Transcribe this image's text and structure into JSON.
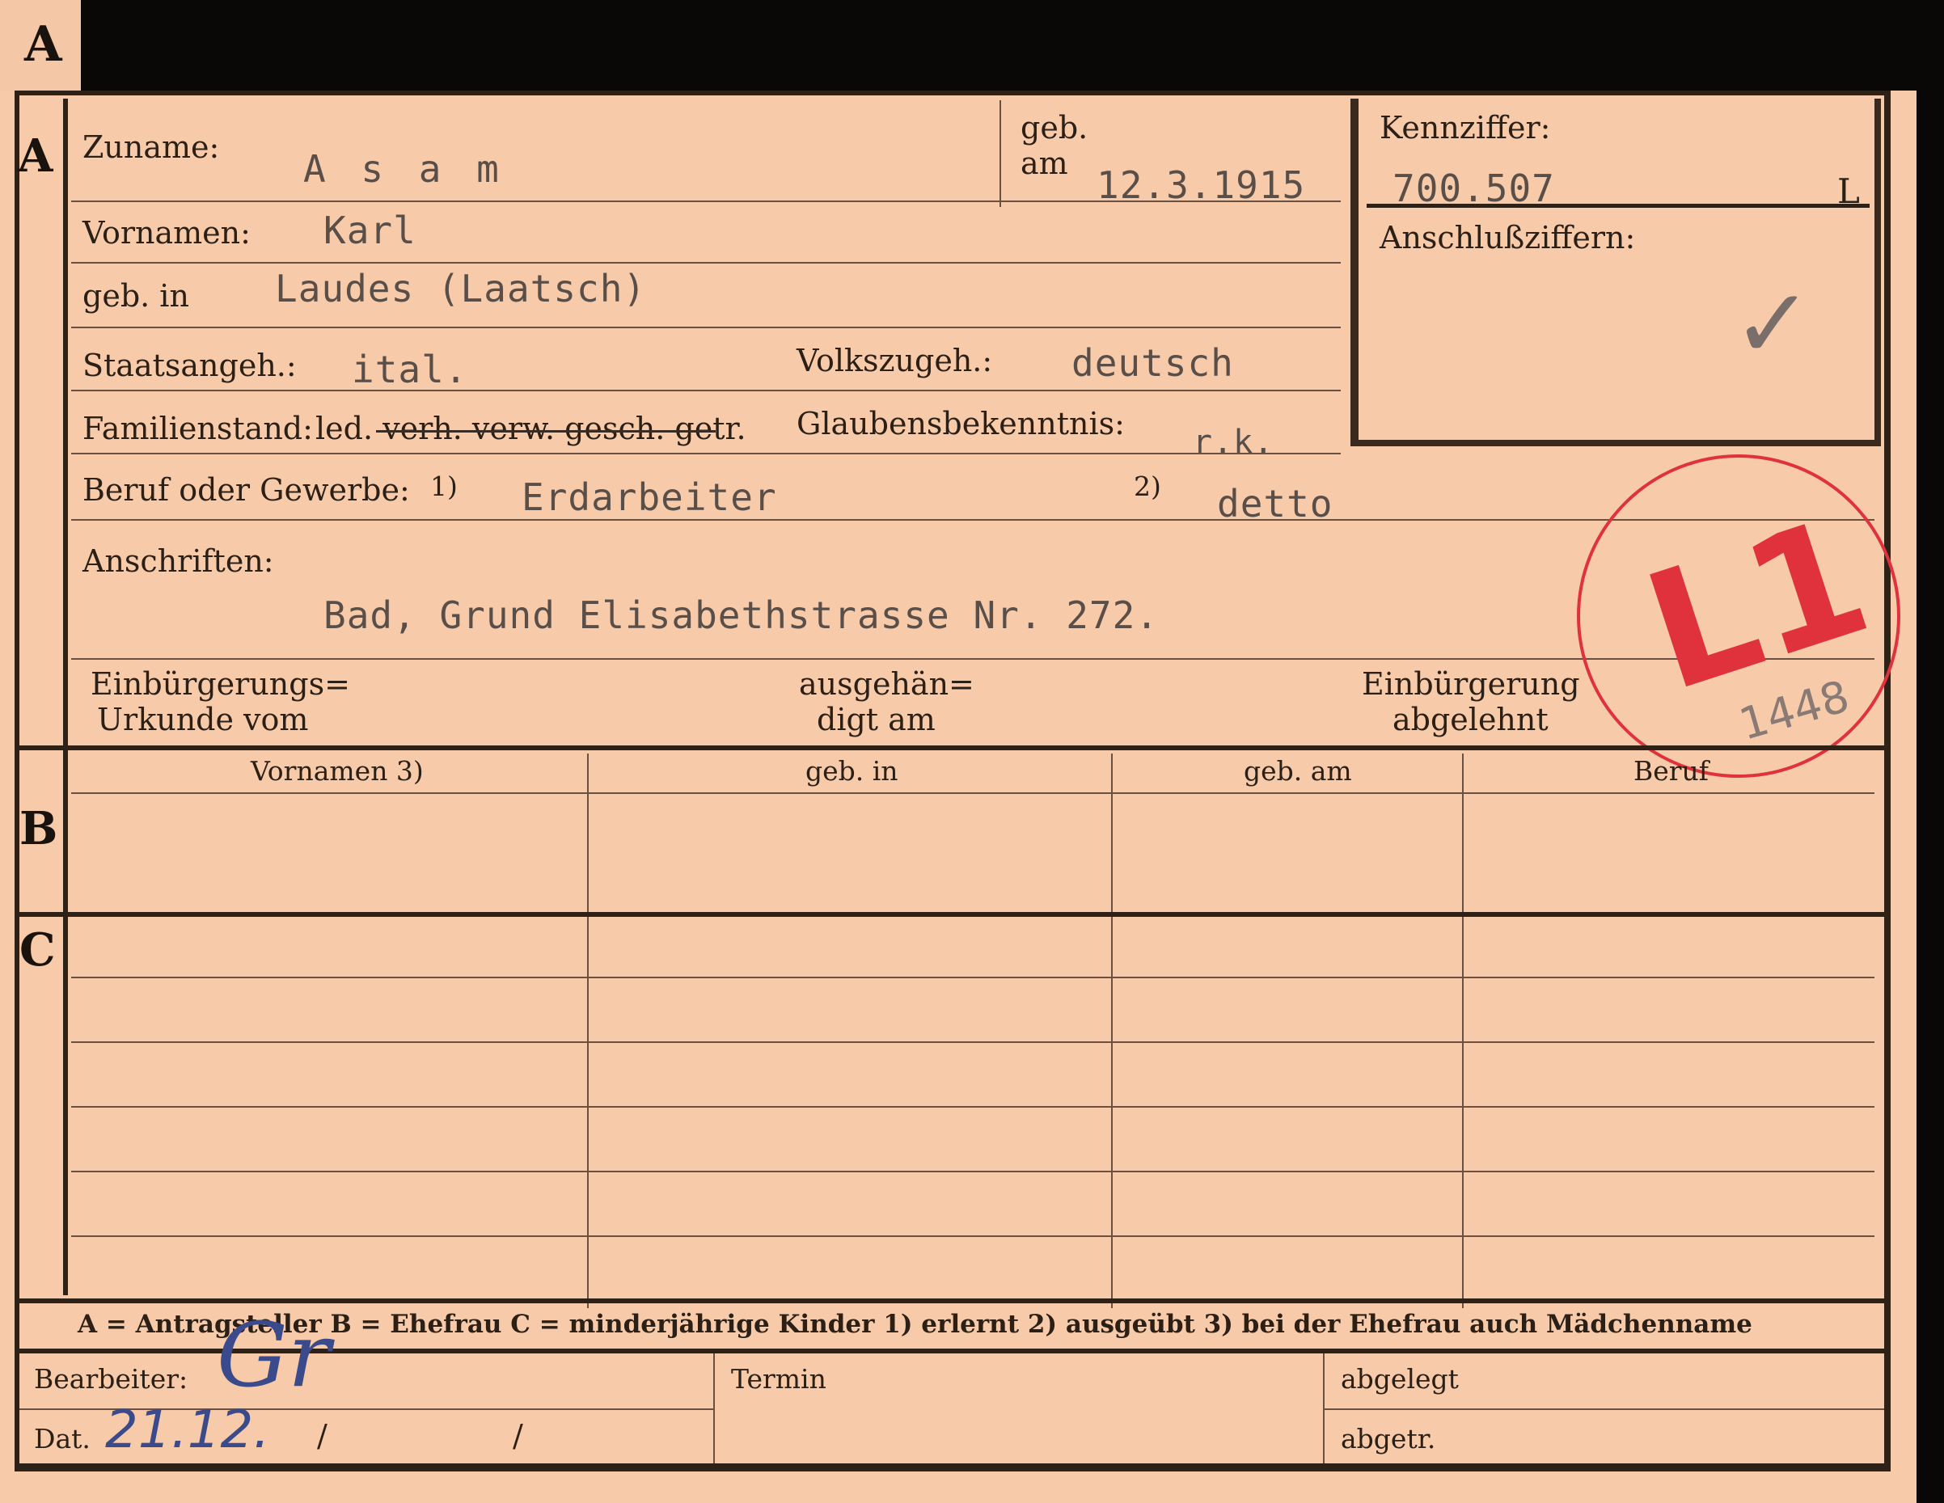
{
  "tab_letter": "A",
  "section_a": {
    "letter": "A",
    "surname_label": "Zuname:",
    "surname_value": "A s a m",
    "born_label_1": "geb.",
    "born_label_2": "am",
    "born_value": "12.3.1915",
    "first_names_label": "Vornamen:",
    "first_names_value": "Karl",
    "birthplace_label": "geb. in",
    "birthplace_value": "Laudes (Laatsch)",
    "citizenship_label": "Staatsangeh.:",
    "citizenship_value": "ital.",
    "ethnicity_label": "Volkszugeh.:",
    "ethnicity_value": "deutsch",
    "marital_label": "Familienstand:",
    "marital_options": "led. verh. verw. gesch. getr.",
    "religion_label": "Glaubensbekenntnis:",
    "religion_value": "r.k.",
    "occupation_label": "Beruf oder Gewerbe:",
    "occupation_note1": "1)",
    "occupation_value": "Erdarbeiter",
    "occupation_note2": "2)",
    "occupation_value2": "detto",
    "addresses_label": "Anschriften:",
    "address_value": "Bad, Grund Elisabethstrasse Nr. 272.",
    "naturalization_label_1": "Einbürgerungs=",
    "naturalization_label_2": "Urkunde vom",
    "handed_label_1": "ausgehän=",
    "handed_label_2": "digt am",
    "rejected_label_1": "Einbürgerung",
    "rejected_label_2": "abgelehnt"
  },
  "id_box": {
    "label": "Kennziffer:",
    "value": "700.507",
    "suffix": "L",
    "connection_label": "Anschlußziffern:",
    "check_mark": "✓"
  },
  "stamp": {
    "text": "L1",
    "handwritten": "1448",
    "color": "#e0323c"
  },
  "section_b": {
    "letter": "B",
    "columns": [
      "Vornamen 3)",
      "geb. in",
      "geb. am",
      "Beruf"
    ]
  },
  "section_c": {
    "letter": "C"
  },
  "legend": "A = Antragsteller   B = Ehefrau   C = minderjährige Kinder   1) erlernt   2) ausgeübt   3) bei der Ehefrau auch Mädchenname",
  "footer": {
    "processor_label": "Bearbeiter:",
    "processor_sign": "Gr",
    "date_label": "Dat.",
    "date_value": "21.12.",
    "slash1": "/",
    "slash2": "/",
    "deadline_label": "Termin",
    "filed_label": "abgelegt",
    "filed_short_label": "abgetr."
  }
}
